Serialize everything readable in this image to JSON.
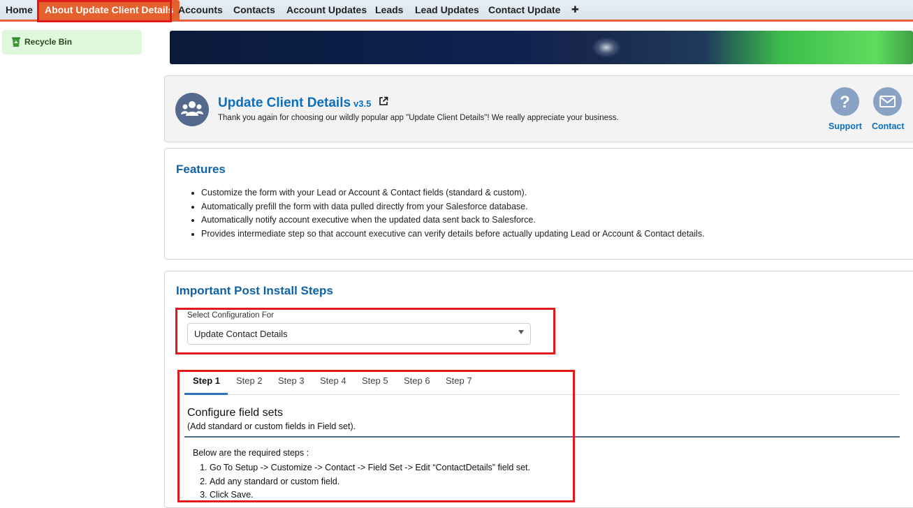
{
  "tabs": [
    {
      "label": "Home"
    },
    {
      "label": "About Update Client Details",
      "active": true
    },
    {
      "label": "Accounts"
    },
    {
      "label": "Contacts"
    },
    {
      "label": "Account Updates"
    },
    {
      "label": "Leads"
    },
    {
      "label": "Lead Updates"
    },
    {
      "label": "Contact Update"
    },
    {
      "label": "✚"
    }
  ],
  "sidebar": {
    "recycle_bin_label": "Recycle Bin",
    "icon": "recycle-bin-icon"
  },
  "app_header": {
    "title": "Update Client Details",
    "version": "v3.5",
    "description": "Thank you again for choosing our wildly popular app \"Update Client Details\"! We really appreciate your business.",
    "support_label": "Support",
    "contact_label": "Contact",
    "icons": [
      "users-icon",
      "external-link-icon",
      "help-icon",
      "mail-icon"
    ]
  },
  "features": {
    "title": "Features",
    "items": [
      "Customize the form with your Lead or Account & Contact fields (standard & custom).",
      "Automatically prefill the form with data pulled directly from your Salesforce database.",
      "Automatically notify account executive when the updated data sent back to Salesforce.",
      "Provides intermediate step so that account executive can verify details before actually updating Lead or Account & Contact details."
    ]
  },
  "install": {
    "title": "Important Post Install Steps",
    "select_label": "Select Configuration For",
    "select_value": "Update Contact Details",
    "step_tabs": [
      "Step 1",
      "Step 2",
      "Step 3",
      "Step 4",
      "Step 5",
      "Step 6",
      "Step 7"
    ],
    "active_step": "Step 1",
    "step_title": "Configure field sets",
    "step_subtitle": "(Add standard or custom fields in Field set).",
    "steps_intro": "Below are the required steps :",
    "steps": [
      "Go To Setup -> Customize -> Contact -> Field Set -> Edit “ContactDetails” field set.",
      "Add any standard or custom field.",
      "Click Save."
    ]
  },
  "colors": {
    "accent_orange": "#e4602d",
    "highlight_red": "#e31a1a",
    "title_blue": "#0f62a8",
    "link_blue": "#0b6fbf"
  }
}
